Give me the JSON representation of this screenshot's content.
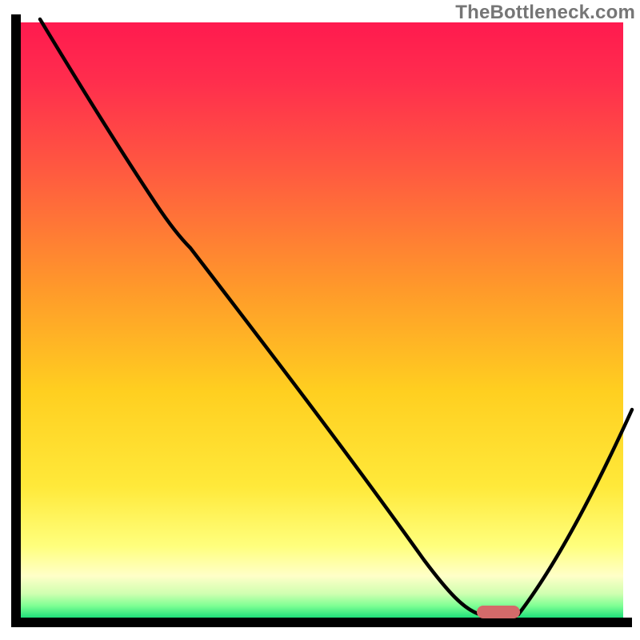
{
  "watermark": "TheBottleneck.com",
  "colors": {
    "gradient_top": "#ff1a4f",
    "gradient_mid_orange": "#ff9a2a",
    "gradient_mid_yellow": "#ffe93a",
    "gradient_bottom": "#1fe07a",
    "curve": "#000000",
    "marker": "#d46a6a",
    "axis": "#000000",
    "watermark_text": "#767676"
  },
  "chart_data": {
    "type": "line",
    "title": "",
    "xlabel": "",
    "ylabel": "",
    "xlim": [
      0,
      100
    ],
    "ylim": [
      0,
      100
    ],
    "grid": false,
    "legend": false,
    "annotations": [
      {
        "name": "optimum",
        "x": 80,
        "y": 0,
        "shape": "pill",
        "color": "#d46a6a"
      }
    ],
    "series": [
      {
        "name": "bottleneck-curve",
        "color": "#000000",
        "x": [
          3,
          10,
          18,
          23,
          27,
          35,
          45,
          55,
          65,
          73,
          77,
          82,
          88,
          94,
          100
        ],
        "y": [
          100,
          85,
          72,
          65,
          60,
          50,
          38,
          25,
          12,
          3,
          0,
          0,
          9,
          22,
          35
        ]
      }
    ],
    "background_gradient": {
      "direction": "vertical",
      "stops": [
        {
          "pos": 0.0,
          "color": "#ff1a4f"
        },
        {
          "pos": 0.25,
          "color": "#ff5a40"
        },
        {
          "pos": 0.45,
          "color": "#ff9a2a"
        },
        {
          "pos": 0.62,
          "color": "#ffcf20"
        },
        {
          "pos": 0.78,
          "color": "#ffe93a"
        },
        {
          "pos": 0.93,
          "color": "#ffffc8"
        },
        {
          "pos": 1.0,
          "color": "#1fe07a"
        }
      ]
    }
  }
}
